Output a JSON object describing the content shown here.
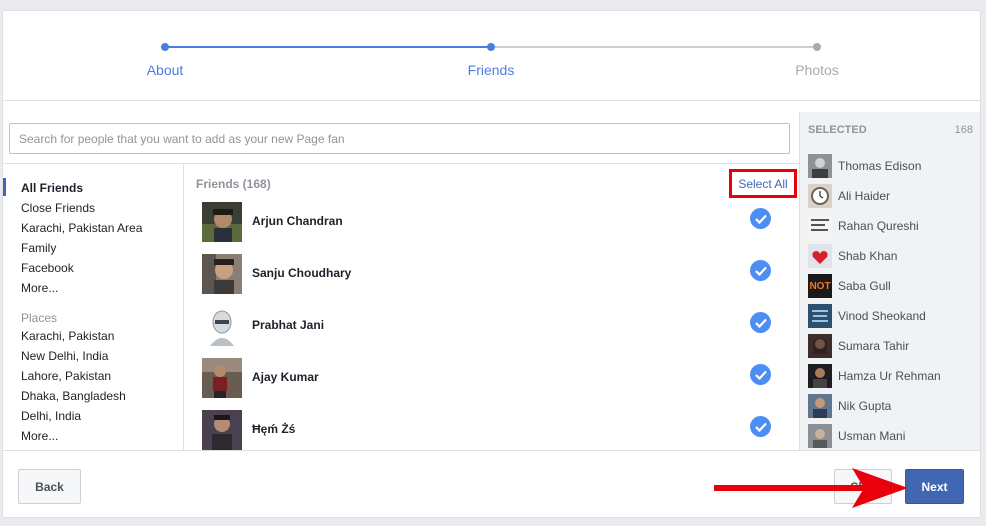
{
  "stepper": {
    "steps": [
      {
        "label": "About",
        "state": "done"
      },
      {
        "label": "Friends",
        "state": "current"
      },
      {
        "label": "Photos",
        "state": "todo"
      }
    ]
  },
  "search": {
    "placeholder": "Search for people that you want to add as your new Page fan"
  },
  "nav": {
    "items": [
      "All Friends",
      "Close Friends",
      "Karachi, Pakistan Area",
      "Family",
      "Facebook",
      "More..."
    ],
    "places_title": "Places",
    "places": [
      "Karachi, Pakistan",
      "New Delhi, India",
      "Lahore, Pakistan",
      "Dhaka, Bangladesh",
      "Delhi, India",
      "More..."
    ]
  },
  "friends": {
    "header": "Friends (168)",
    "select_all": "Select All",
    "list": [
      {
        "name": "Arjun Chandran",
        "checked": true
      },
      {
        "name": "Sanju Choudhary",
        "checked": true
      },
      {
        "name": "Prabhat Jani",
        "checked": true
      },
      {
        "name": "Ajay Kumar",
        "checked": true
      },
      {
        "name": "Ħęḿ Żś",
        "checked": true
      }
    ]
  },
  "selected": {
    "title": "SELECTED",
    "count": "168",
    "items": [
      "Thomas Edison",
      "Ali Haider",
      "Rahan Qureshi",
      "Shab Khan",
      "Saba Gull",
      "Vinod Sheokand",
      "Sumara Tahir",
      "Hamza Ur Rehman",
      "Nik Gupta",
      "Usman Mani"
    ],
    "avatar_text": {
      "saba": "NOT"
    }
  },
  "footer": {
    "back": "Back",
    "skip": "Skip",
    "next": "Next"
  },
  "colors": {
    "accent": "#4c7de0",
    "next_button": "#4267b2",
    "highlight_box": "#e8000c",
    "arrow": "#e8000c"
  }
}
